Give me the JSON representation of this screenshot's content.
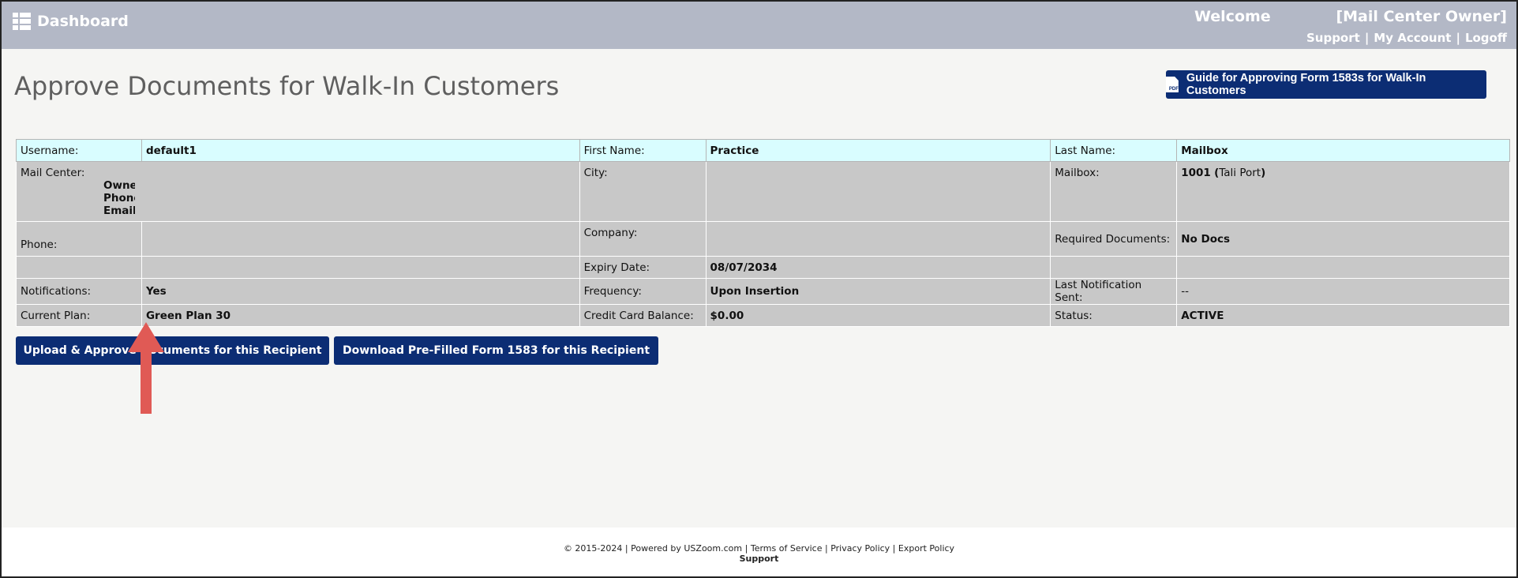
{
  "header": {
    "dashboard_label": "Dashboard",
    "welcome": "Welcome",
    "role": "[Mail Center Owner]",
    "links": [
      "Support",
      "My Account",
      "Logoff"
    ],
    "separator": "|"
  },
  "page": {
    "title": "Approve Documents for Walk-In Customers",
    "guide_button": "Guide for Approving Form 1583s for Walk-In Customers"
  },
  "info": {
    "username_label": "Username:",
    "username": "default1",
    "first_name_label": "First Name:",
    "first_name": "Practice",
    "last_name_label": "Last Name:",
    "last_name": "Mailbox",
    "mail_center_label": "Mail Center:",
    "owner_label": "Owner",
    "phone_sub_label": "Phone",
    "email_label": "Email:",
    "city_label": "City:",
    "mailbox_label": "Mailbox:",
    "mailbox_number": "1001",
    "mailbox_paren_open": "(",
    "mailbox_location": "Tali Port",
    "mailbox_paren_close": ")",
    "phone_label": "Phone:",
    "company_label": "Company:",
    "required_docs_label": "Required Documents:",
    "required_docs": "No Docs",
    "expiry_label": "Expiry Date:",
    "expiry": "08/07/2034",
    "notifications_label": "Notifications:",
    "notifications": "Yes",
    "frequency_label": "Frequency:",
    "frequency": "Upon Insertion",
    "last_notification_label": "Last Notification Sent:",
    "last_notification": "--",
    "plan_label": "Current Plan:",
    "plan": "Green Plan 30",
    "cc_balance_label": "Credit Card Balance:",
    "cc_balance": "$0.00",
    "status_label": "Status:",
    "status": "ACTIVE"
  },
  "actions": {
    "upload_button": "Upload & Approve Documents for this Recipient",
    "download_button": "Download Pre-Filled Form 1583 for this Recipient"
  },
  "footer": {
    "copyright": "© 2015-2024",
    "powered_by": "Powered by USZoom.com",
    "terms": "Terms of Service",
    "privacy": "Privacy Policy",
    "export": "Export Policy",
    "support": "Support",
    "separator": "|"
  },
  "colors": {
    "topbar": "#b3b8c6",
    "button_blue": "#0c2d74",
    "highlight_row": "#d9fdff",
    "row_gray": "#c8c8c8",
    "arrow_red": "#e05a55"
  }
}
